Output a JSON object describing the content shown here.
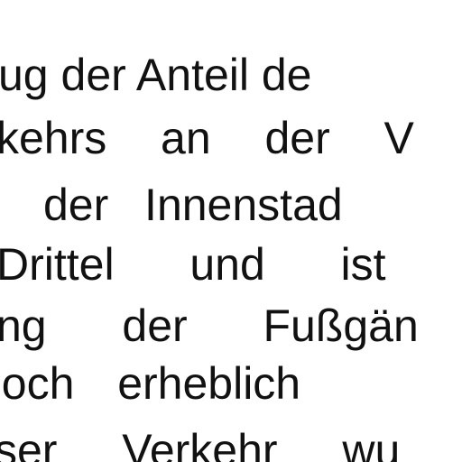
{
  "document": {
    "lines": [
      "ug der Anteil de",
      "kehrs  an  der  V",
      "der  Innenstad",
      "Drittel  und  ist",
      "ng  der  Fußgän",
      "noch  erheblich",
      "ser  Verkehr  wu"
    ]
  }
}
